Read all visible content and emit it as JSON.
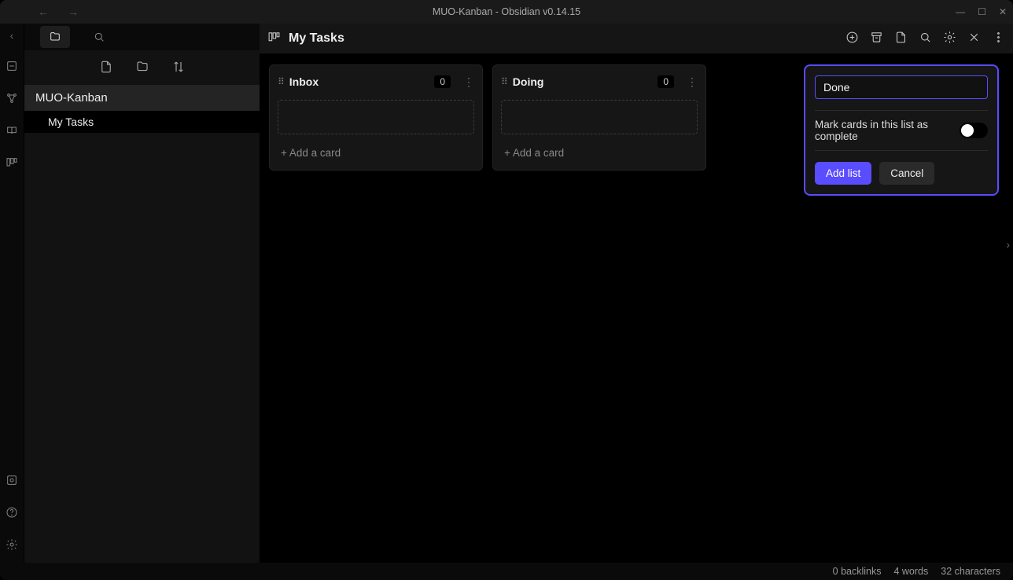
{
  "window": {
    "title": "MUO-Kanban - Obsidian v0.14.15"
  },
  "sidebar": {
    "vault_name": "MUO-Kanban",
    "files": [
      {
        "name": "My Tasks"
      }
    ]
  },
  "page": {
    "title": "My Tasks"
  },
  "board": {
    "columns": [
      {
        "title": "Inbox",
        "count": "0",
        "add_label": "+ Add a card"
      },
      {
        "title": "Doing",
        "count": "0",
        "add_label": "+ Add a card"
      }
    ],
    "new_list": {
      "input_value": "Done",
      "mark_complete_label": "Mark cards in this list as complete",
      "add_label": "Add list",
      "cancel_label": "Cancel"
    }
  },
  "status": {
    "backlinks": "0 backlinks",
    "words": "4 words",
    "chars": "32 characters"
  }
}
